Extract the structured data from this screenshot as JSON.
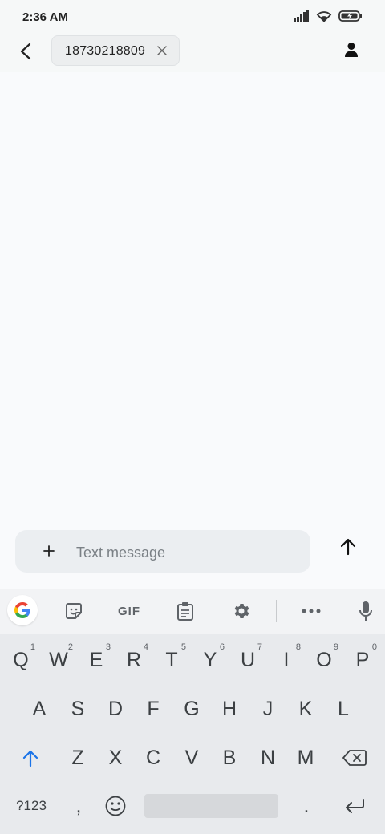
{
  "status_bar": {
    "time": "2:36 AM"
  },
  "header": {
    "recipient": "18730218809",
    "icons": {
      "back": "arrow-back-icon",
      "remove": "close-icon",
      "contact": "person-icon"
    }
  },
  "compose": {
    "placeholder": "Text message",
    "value": "",
    "icons": {
      "attach": "plus-icon",
      "send": "arrow-up-icon"
    }
  },
  "keyboard": {
    "toolbar": [
      "google-icon",
      "sticker-icon",
      "gif",
      "clipboard-icon",
      "gear-icon",
      "more-icon",
      "mic-icon"
    ],
    "gif_label": "GIF",
    "row1": [
      {
        "k": "Q",
        "h": "1"
      },
      {
        "k": "W",
        "h": "2"
      },
      {
        "k": "E",
        "h": "3"
      },
      {
        "k": "R",
        "h": "4"
      },
      {
        "k": "T",
        "h": "5"
      },
      {
        "k": "Y",
        "h": "6"
      },
      {
        "k": "U",
        "h": "7"
      },
      {
        "k": "I",
        "h": "8"
      },
      {
        "k": "O",
        "h": "9"
      },
      {
        "k": "P",
        "h": "0"
      }
    ],
    "row2": [
      "A",
      "S",
      "D",
      "F",
      "G",
      "H",
      "J",
      "K",
      "L"
    ],
    "row3": [
      "Z",
      "X",
      "C",
      "V",
      "B",
      "N",
      "M"
    ],
    "symbols_label": "?123",
    "comma": ",",
    "period": ".",
    "accent_color": "#1a73e8"
  }
}
